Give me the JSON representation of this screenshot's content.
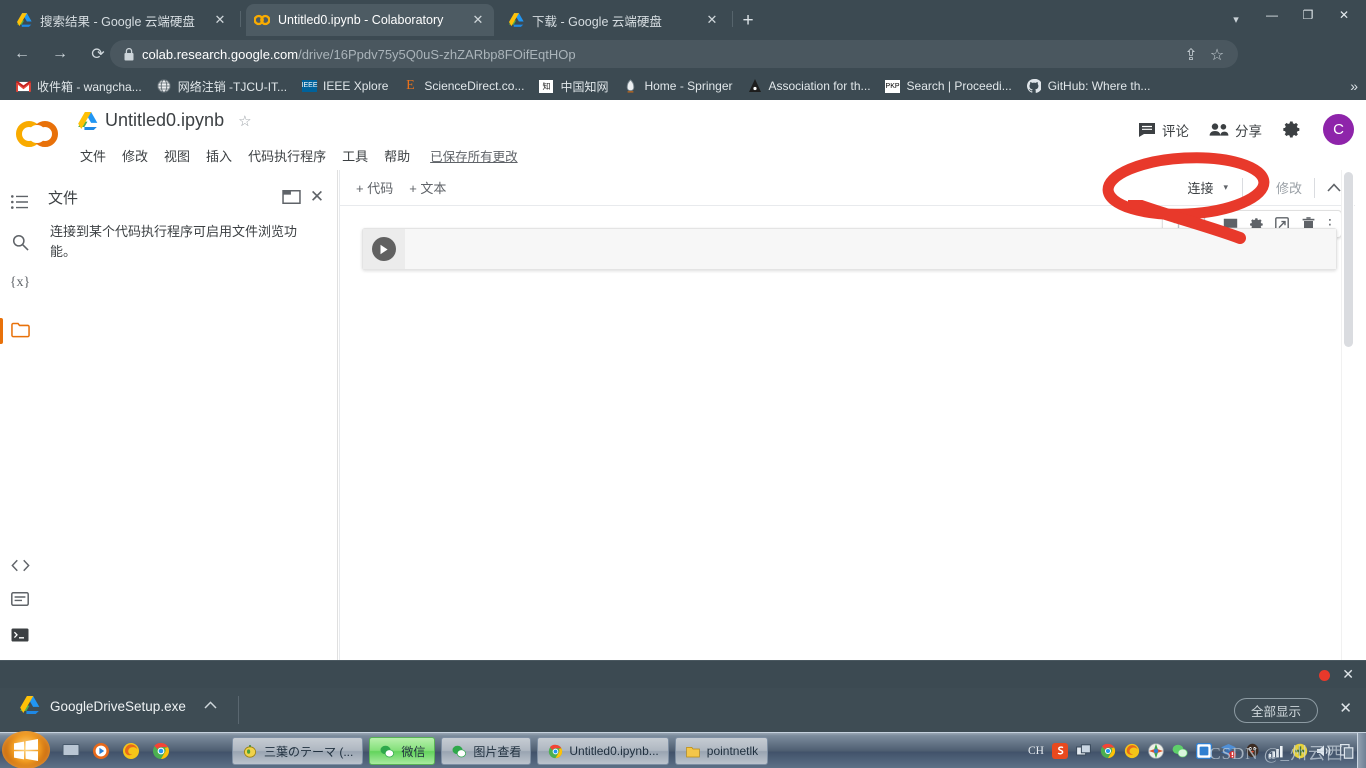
{
  "browser": {
    "tabs": [
      {
        "title": "搜索结果 - Google 云端硬盘",
        "favicon": "drive-icon",
        "active": false,
        "close": "✕"
      },
      {
        "title": "Untitled0.ipynb - Colaboratory",
        "favicon": "colab-icon",
        "active": true,
        "close": "✕"
      },
      {
        "title": "下载 - Google 云端硬盘",
        "favicon": "drive-icon",
        "active": false,
        "close": "✕"
      }
    ],
    "new_tab_label": "+",
    "window_controls": {
      "minimize": "—",
      "maximize": "❐",
      "close": "✕"
    },
    "nav": {
      "back": "←",
      "forward": "→",
      "reload": "⟳"
    },
    "url": {
      "scheme_host": "colab.research.google.com",
      "path": "/drive/16Ppdv75y5Q0uS-zhZARbp8FOifEqtHOp"
    },
    "omnibox_right": {
      "share": "⇪",
      "bookmark": "☆"
    },
    "toolbar_right": {
      "extensions": "puzzle-icon",
      "sidepanel": "panel-icon",
      "profile": "C",
      "menu": "⋮"
    },
    "bookmarks": [
      {
        "label": "收件箱 - wangcha...",
        "icon": "gmail-icon"
      },
      {
        "label": "网络注销 -TJCU-IT...",
        "icon": "globe-icon"
      },
      {
        "label": "IEEE Xplore",
        "icon": "ieee-icon"
      },
      {
        "label": "ScienceDirect.co...",
        "icon": "elsevier-icon"
      },
      {
        "label": "中国知网",
        "icon": "cnki-icon"
      },
      {
        "label": "Home - Springer",
        "icon": "springer-icon"
      },
      {
        "label": "Association for th...",
        "icon": "acm-icon"
      },
      {
        "label": "Search | Proceedi...",
        "icon": "pkp-icon"
      },
      {
        "label": "GitHub: Where th...",
        "icon": "github-icon"
      }
    ],
    "bookmarks_overflow": "»"
  },
  "colab": {
    "logo": "colab-logo",
    "notebook_title": "Untitled0.ipynb",
    "star": "☆",
    "menu": [
      "文件",
      "修改",
      "视图",
      "插入",
      "代码执行程序",
      "工具",
      "帮助"
    ],
    "saved_status": "已保存所有更改",
    "header_actions": [
      {
        "label": "评论",
        "icon": "comment-icon"
      },
      {
        "label": "分享",
        "icon": "people-icon"
      }
    ],
    "settings_icon": "gear-icon",
    "account_initial": "C",
    "rail": [
      {
        "name": "toc-icon",
        "glyph": "≡",
        "active": false
      },
      {
        "name": "search-icon",
        "glyph": "⌕",
        "active": false
      },
      {
        "name": "variables-icon",
        "glyph": "{x}",
        "active": false
      },
      {
        "name": "files-icon",
        "glyph": "▭",
        "active": true
      },
      {
        "name": "code-snippets-icon",
        "glyph": "< >",
        "active": false
      },
      {
        "name": "command-palette-icon",
        "glyph": "▤",
        "active": false
      },
      {
        "name": "terminal-icon",
        "glyph": ">_",
        "active": false
      }
    ],
    "files_panel": {
      "title": "文件",
      "upload_icon": "new-folder-icon",
      "close_icon": "✕",
      "empty_message": "连接到某个代码执行程序可启用文件浏览功能。"
    },
    "notebook_toolbar": {
      "add_code": "+ 代码",
      "add_text": "+ 文本",
      "connect_label": "连接",
      "connect_caret": "▾",
      "edit_label": "修改",
      "edit_icon": "pencil-icon",
      "collapse_icon": "chevron-up-icon"
    },
    "cell_toolbar": [
      {
        "name": "move-cell-up-icon",
        "glyph": "↑",
        "dim": true
      },
      {
        "name": "move-cell-down-icon",
        "glyph": "↓",
        "dim": true
      },
      {
        "name": "comment-cell-icon",
        "glyph": "▤",
        "dim": false
      },
      {
        "name": "cell-settings-icon",
        "glyph": "⚙",
        "dim": false
      },
      {
        "name": "open-in-tab-icon",
        "glyph": "⇱",
        "dim": false
      },
      {
        "name": "delete-cell-icon",
        "glyph": "🗑",
        "dim": false
      },
      {
        "name": "more-options-icon",
        "glyph": "⋮",
        "dim": false
      }
    ],
    "cell": {
      "run_icon": "play-icon",
      "code": ""
    }
  },
  "download_shelf": {
    "file_name": "GoogleDriveSetup.exe",
    "file_icon": "drive-icon",
    "item_caret": "⌃",
    "show_all_label": "全部显示",
    "close_label": "✕"
  },
  "taskbar": {
    "start": "start-orb",
    "quick_launch": [
      "show-desktop-icon",
      "media-player-icon",
      "ie-icon",
      "chrome-icon"
    ],
    "windows": [
      {
        "label": "三葉のテーマ (...",
        "icon": "media-icon",
        "highlight": false
      },
      {
        "label": "微信",
        "icon": "wechat-icon",
        "highlight": true
      },
      {
        "label": "图片查看",
        "icon": "wechat-icon",
        "highlight": false
      },
      {
        "label": "Untitled0.ipynb...",
        "icon": "chrome-icon",
        "highlight": false
      },
      {
        "label": "pointnetlk",
        "icon": "folder-icon",
        "highlight": false
      }
    ],
    "tray": {
      "input_method": "CH",
      "icons": [
        "sogou-icon",
        "windows-icon",
        "chrome-icon",
        "firefox-icon",
        "browser-icon",
        "wechat-icon",
        "onedrive-icon",
        "stack-icon",
        "qq-icon",
        "network-icon",
        "update-icon",
        "volume-icon",
        "copy-icon"
      ]
    }
  },
  "watermark": "CSDN @_州云西",
  "colors": {
    "chrome_frame": "#3c4a52",
    "colab_orange": "#e8710a",
    "annotation_red": "#e8392b",
    "avatar_purple": "#8e24aa"
  }
}
